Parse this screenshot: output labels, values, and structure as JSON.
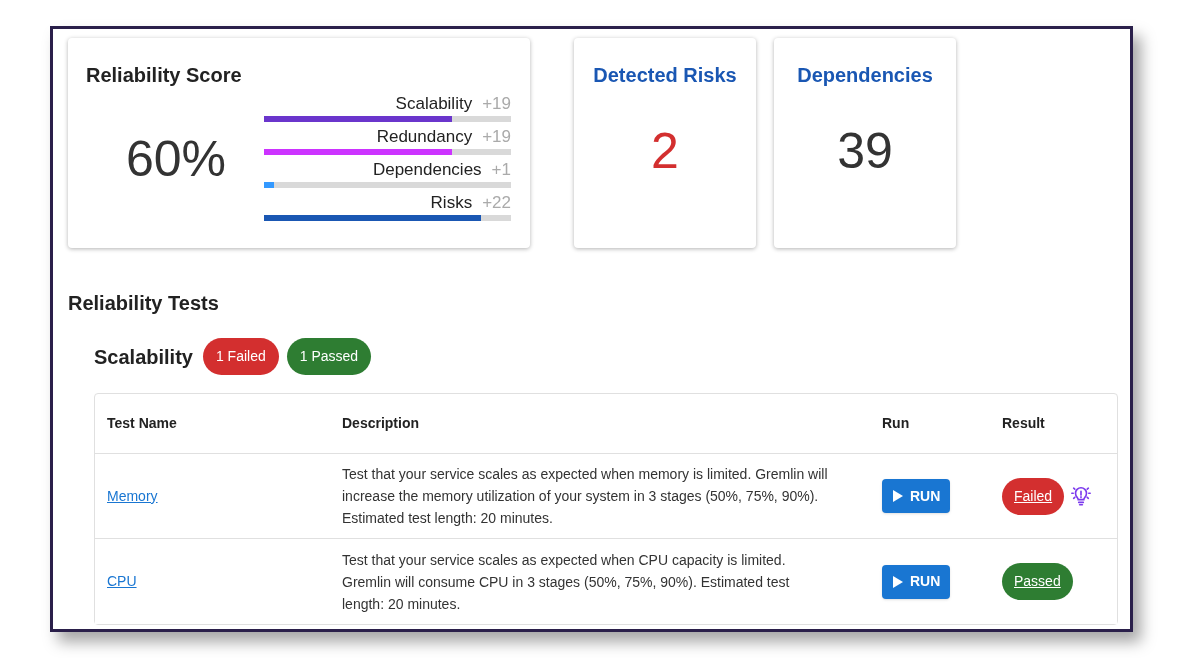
{
  "score_card": {
    "title": "Reliability Score",
    "score": "60%",
    "metrics": [
      {
        "label": "Scalability",
        "delta": "+19",
        "level": 0.76,
        "color": "#6a35cc"
      },
      {
        "label": "Redundancy",
        "delta": "+19",
        "level": 0.76,
        "color": "#cc33ff"
      },
      {
        "label": "Dependencies",
        "delta": "+1",
        "level": 0.04,
        "color": "#3399ff"
      },
      {
        "label": "Risks",
        "delta": "+22",
        "level": 0.88,
        "color": "#1a57b3"
      }
    ]
  },
  "stat_cards": [
    {
      "title": "Detected Risks",
      "value": "2",
      "kind": "alert"
    },
    {
      "title": "Dependencies",
      "value": "39",
      "kind": "neutral"
    }
  ],
  "section_title": "Reliability Tests",
  "group": {
    "title": "Scalability",
    "badges": [
      {
        "label": "1 Failed",
        "kind": "failed"
      },
      {
        "label": "1 Passed",
        "kind": "passed"
      }
    ],
    "table": {
      "columns": [
        "Test Name",
        "Description",
        "Run",
        "Result"
      ],
      "rows": [
        {
          "name": "Memory",
          "description": "Test that your service scales as expected when memory is limited. Gremlin will increase the memory utilization of your system in 3 stages (50%, 75%, 90%). Estimated test length: 20 minutes.",
          "run": "RUN",
          "result": "Failed",
          "kind": "failed",
          "hint": true
        },
        {
          "name": "CPU",
          "description": "Test that your service scales as expected when CPU capacity is limited. Gremlin will consume CPU in 3 stages (50%, 75%, 90%). Estimated test length: 20 minutes.",
          "run": "RUN",
          "result": "Passed",
          "kind": "passed",
          "hint": false
        }
      ]
    }
  }
}
